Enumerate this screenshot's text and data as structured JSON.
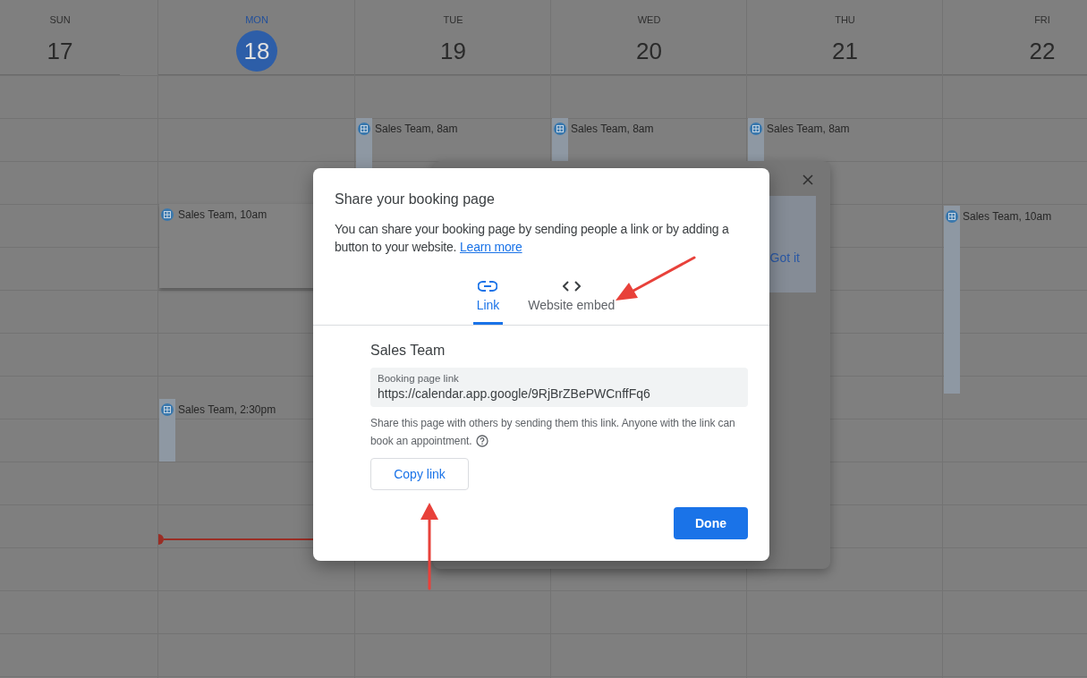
{
  "calendar": {
    "days": [
      {
        "weekday": "SUN",
        "date": "17",
        "selected": false
      },
      {
        "weekday": "MON",
        "date": "18",
        "selected": true,
        "current_time_line": true,
        "events": [
          {
            "text": "**Sales Team**, 10am"
          },
          {
            "text": "**Sales Team**, 2:30pm"
          }
        ]
      },
      {
        "weekday": "TUE",
        "date": "19",
        "selected": false,
        "events": [
          {
            "text": "**Sales Team**, 8am"
          }
        ]
      },
      {
        "weekday": "WED",
        "date": "20",
        "selected": false,
        "events": [
          {
            "text": "**Sales Team**, 8am"
          }
        ]
      },
      {
        "weekday": "THU",
        "date": "21",
        "selected": false,
        "events": [
          {
            "text": "**Sales Team**, 8am"
          }
        ]
      },
      {
        "weekday": "FRI",
        "date": "22",
        "selected": false,
        "events": [
          {
            "text": "**Sales Team**, 10am"
          }
        ]
      }
    ]
  },
  "background_dialog": {
    "button": "Got it"
  },
  "dialog": {
    "title": "Share your booking page",
    "description": "You can share your booking page by sending people a link or by adding a button to your website.",
    "learn_more": "Learn more",
    "tabs": [
      {
        "label": "Link",
        "kind": "link",
        "selected": true
      },
      {
        "label": "Website embed",
        "kind": "embed",
        "selected": false
      }
    ],
    "page_title": "Sales Team",
    "field": {
      "label": "Booking page link",
      "value": "https://calendar.app.google/9RjBrZBePWCnffFq6"
    },
    "help": "Share this page with others by sending them this link. Anyone with the link can book an appointment.",
    "copy_button": "Copy link",
    "done_button": "Done"
  }
}
